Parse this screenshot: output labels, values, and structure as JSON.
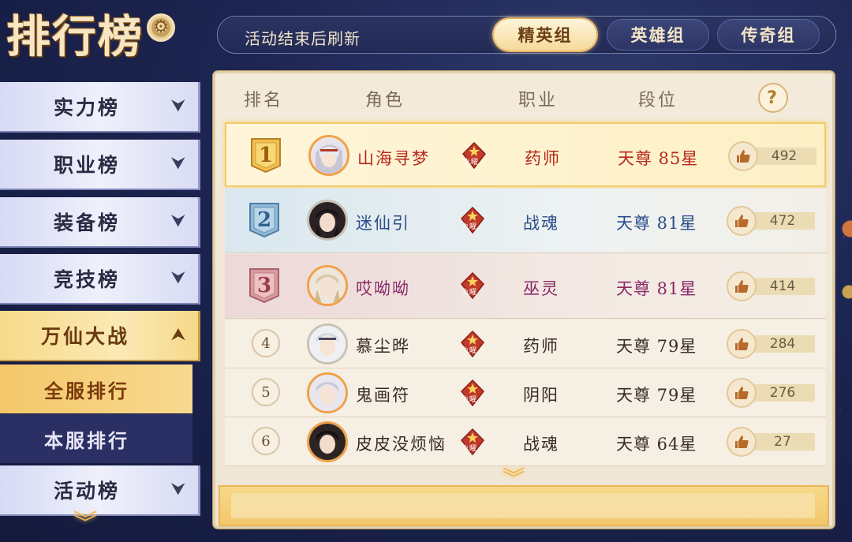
{
  "header": {
    "title": "排行榜",
    "notice": "活动结束后刷新",
    "tabs": [
      {
        "label": "精英组",
        "active": true
      },
      {
        "label": "英雄组",
        "active": false
      },
      {
        "label": "传奇组",
        "active": false
      }
    ]
  },
  "sidebar": {
    "items": [
      {
        "label": "实力榜"
      },
      {
        "label": "职业榜"
      },
      {
        "label": "装备榜"
      },
      {
        "label": "竞技榜"
      },
      {
        "label": "万仙大战",
        "expanded": true
      },
      {
        "label": "活动榜"
      }
    ],
    "subitems": [
      {
        "label": "全服排行",
        "selected": true
      },
      {
        "label": "本服排行",
        "selected": false
      }
    ]
  },
  "table": {
    "headers": {
      "rank": "排名",
      "role": "角色",
      "job": "职业",
      "tier": "段位",
      "help": "?"
    },
    "rows": [
      {
        "rank": "1",
        "name": "山海寻梦",
        "badge": "九曜",
        "job": "药师",
        "tier": "天尊  85星",
        "likes": "492"
      },
      {
        "rank": "2",
        "name": "迷仙引",
        "badge": "九曜",
        "job": "战魂",
        "tier": "天尊  81星",
        "likes": "472"
      },
      {
        "rank": "3",
        "name": "哎呦呦",
        "badge": "九曜",
        "job": "巫灵",
        "tier": "天尊  81星",
        "likes": "414"
      },
      {
        "rank": "4",
        "name": "慕尘晔",
        "badge": "九曜",
        "job": "药师",
        "tier": "天尊  79星",
        "likes": "284"
      },
      {
        "rank": "5",
        "name": "鬼画符",
        "badge": "九曜",
        "job": "阴阳",
        "tier": "天尊  79星",
        "likes": "276"
      },
      {
        "rank": "6",
        "name": "皮皮没烦恼",
        "badge": "九曜",
        "job": "战魂",
        "tier": "天尊  64星",
        "likes": "27"
      }
    ]
  },
  "colors": {
    "gold": "#f2cb6a",
    "silver_blue": "#2a4d8a",
    "bronze_purple": "#8a2a66",
    "highlight_red": "#b6281e",
    "panel_bg": "#f3eadb"
  },
  "icons": {
    "settings": "gear-icon",
    "expand": "chevron-down-icon",
    "collapse": "chevron-up-icon",
    "like": "thumbs-up-icon",
    "help": "question-icon",
    "more": "double-chevron-down-icon"
  }
}
